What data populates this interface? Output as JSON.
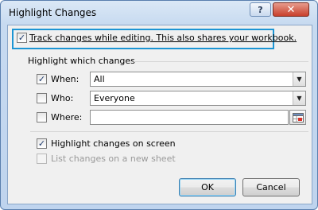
{
  "window": {
    "title": "Highlight Changes",
    "help_glyph": "?",
    "close_glyph": "✕"
  },
  "track_changes": {
    "label": "Track changes while editing. This also shares your workbook.",
    "checked": true
  },
  "highlight_group": {
    "title": "Highlight which changes",
    "when": {
      "label": "When:",
      "checked": true,
      "value": "All"
    },
    "who": {
      "label": "Who:",
      "checked": false,
      "value": "Everyone"
    },
    "where": {
      "label": "Where:",
      "checked": false,
      "value": ""
    }
  },
  "options": {
    "highlight_on_screen": {
      "label": "Highlight changes on screen",
      "checked": true
    },
    "list_on_new_sheet": {
      "label": "List changes on a new sheet",
      "checked": false,
      "disabled": true
    }
  },
  "buttons": {
    "ok": "OK",
    "cancel": "Cancel"
  },
  "glyphs": {
    "check": "✓",
    "dropdown": "▼"
  },
  "colors": {
    "highlight_outline": "#1c95d4"
  }
}
